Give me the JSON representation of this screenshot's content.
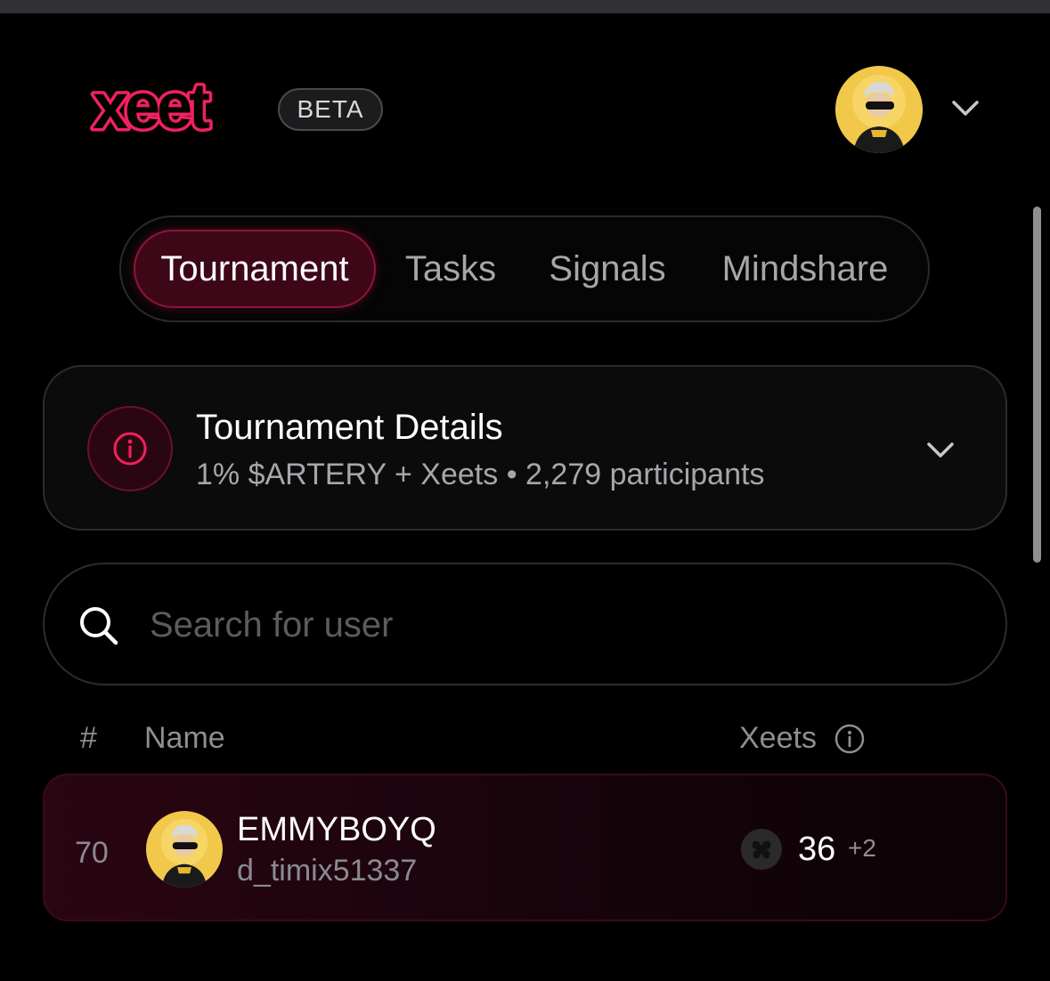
{
  "header": {
    "logo_text": "xeet",
    "badge": "BETA",
    "brand_color": "#f0215e"
  },
  "tabs": [
    {
      "label": "Tournament",
      "active": true
    },
    {
      "label": "Tasks",
      "active": false
    },
    {
      "label": "Signals",
      "active": false
    },
    {
      "label": "Mindshare",
      "active": false
    }
  ],
  "details": {
    "title": "Tournament Details",
    "subtitle": "1% $ARTERY + Xeets • 2,279 participants",
    "icon": "info-icon"
  },
  "search": {
    "placeholder": "Search for user",
    "value": ""
  },
  "table": {
    "columns": {
      "rank": "#",
      "name": "Name",
      "xeets": "Xeets"
    },
    "rows": [
      {
        "rank": "70",
        "display_name": "EMMYBOYQ",
        "handle": "d_timix51337",
        "xeets": "36",
        "delta": "+2"
      }
    ]
  }
}
